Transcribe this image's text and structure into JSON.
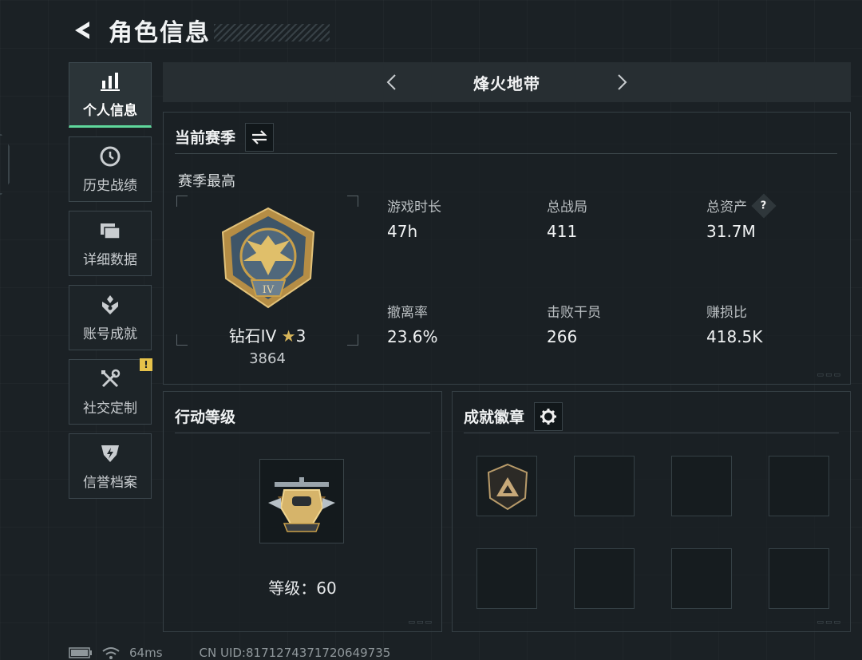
{
  "header": {
    "title": "角色信息"
  },
  "sidebar": {
    "items": [
      {
        "label": "个人信息",
        "icon": "bar-chart-icon",
        "active": true
      },
      {
        "label": "历史战绩",
        "icon": "clock-history-icon"
      },
      {
        "label": "详细数据",
        "icon": "folder-stack-icon"
      },
      {
        "label": "账号成就",
        "icon": "achievement-emblem-icon"
      },
      {
        "label": "社交定制",
        "icon": "tools-icon",
        "badge": "!"
      },
      {
        "label": "信誉档案",
        "icon": "credit-shield-icon"
      }
    ]
  },
  "mode": {
    "title": "烽火地带"
  },
  "season": {
    "title": "当前赛季",
    "subtitle": "赛季最高",
    "rank_name": "钻石IV",
    "rank_stars": "3",
    "rank_score": "3864",
    "stats": [
      {
        "label": "游戏时长",
        "value": "47h"
      },
      {
        "label": "总战局",
        "value": "411"
      },
      {
        "label": "总资产",
        "value": "31.7M",
        "help": "?"
      },
      {
        "label": "撤离率",
        "value": "23.6%"
      },
      {
        "label": "击败干员",
        "value": "266"
      },
      {
        "label": "赚损比",
        "value": "418.5K"
      }
    ]
  },
  "level": {
    "title": "行动等级",
    "text": "等级：60"
  },
  "badges": {
    "title": "成就徽章"
  },
  "status": {
    "ping": "64ms",
    "uid": "CN UID:8171274371720649735"
  },
  "colors": {
    "accent": "#5fd89c",
    "warning": "#e6c24a",
    "background": "#1b2125",
    "gold": "#c9a04a"
  }
}
